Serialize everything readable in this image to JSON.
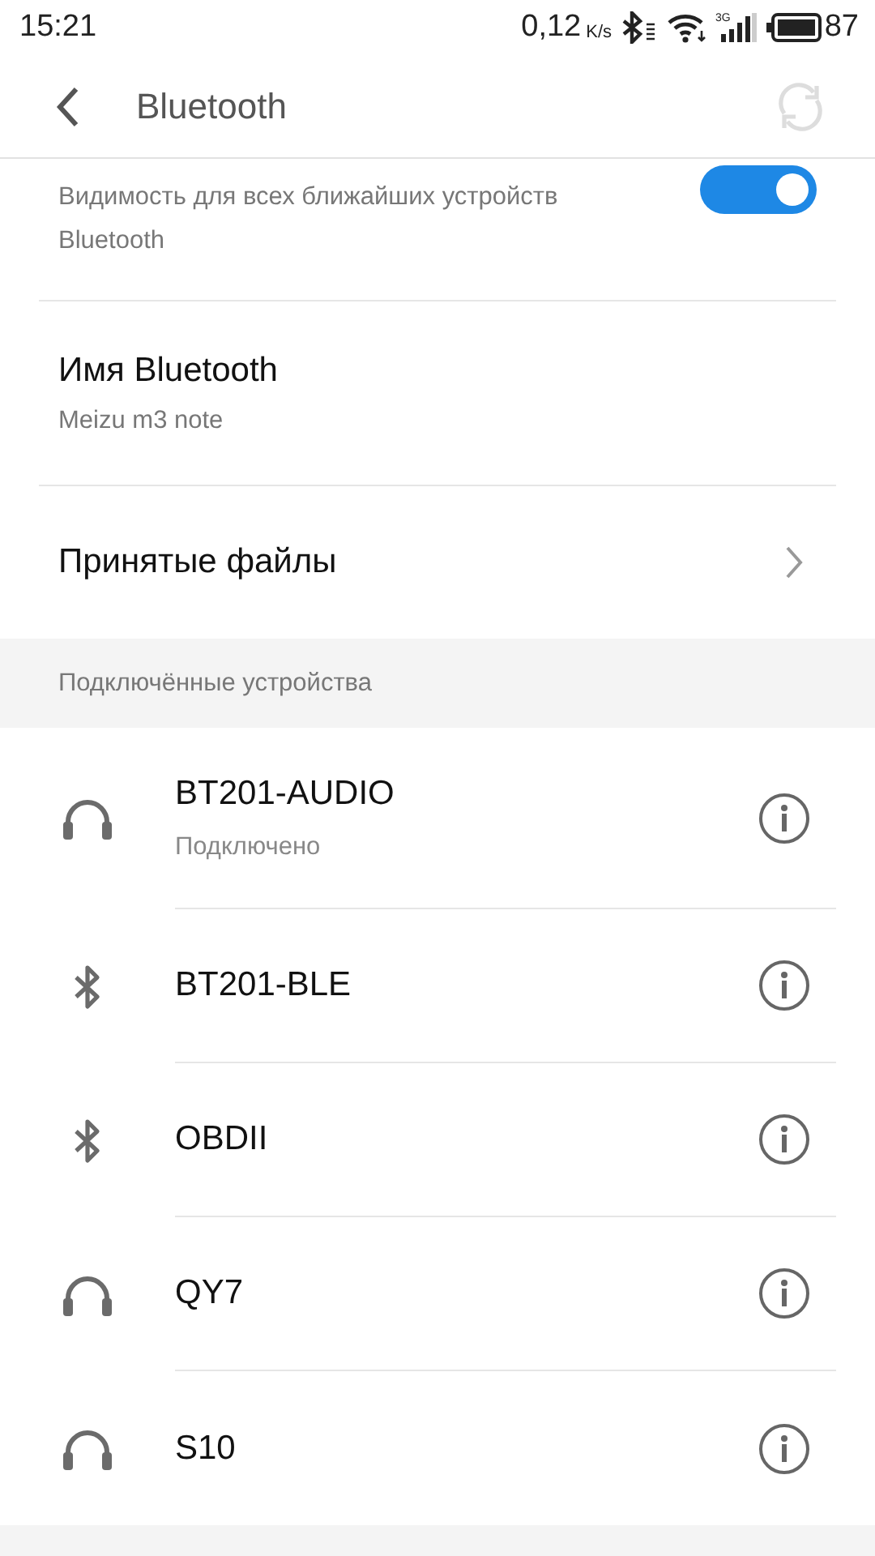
{
  "status_bar": {
    "time": "15:21",
    "net_speed": "0,12",
    "net_unit": "K/s",
    "network_type": "3G",
    "battery": "87"
  },
  "header": {
    "title": "Bluetooth"
  },
  "visibility": {
    "subtitle": "Видимость для всех ближайших устройств Bluetooth",
    "on": true
  },
  "name_row": {
    "title": "Имя Bluetooth",
    "value": "Meizu m3 note"
  },
  "files_row": {
    "title": "Принятые файлы"
  },
  "section": {
    "title": "Подключённые устройства"
  },
  "devices": [
    {
      "kind": "headphones",
      "name": "BT201-AUDIO",
      "status": "Подключено"
    },
    {
      "kind": "bluetooth",
      "name": "BT201-BLE"
    },
    {
      "kind": "bluetooth",
      "name": "OBDII"
    },
    {
      "kind": "headphones",
      "name": "QY7"
    },
    {
      "kind": "headphones",
      "name": "S10"
    }
  ]
}
